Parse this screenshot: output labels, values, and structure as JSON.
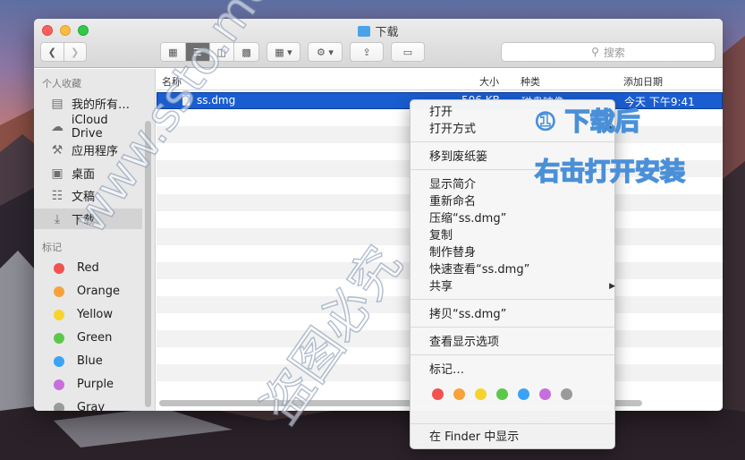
{
  "window": {
    "title": "下载"
  },
  "toolbar": {
    "search_placeholder": "搜索"
  },
  "sidebar": {
    "favorites_header": "个人收藏",
    "favorites": [
      {
        "label": "我的所有…",
        "icon": "all-files-icon"
      },
      {
        "label": "iCloud Drive",
        "icon": "cloud-icon"
      },
      {
        "label": "应用程序",
        "icon": "applications-icon"
      },
      {
        "label": "桌面",
        "icon": "desktop-icon"
      },
      {
        "label": "文稿",
        "icon": "documents-icon"
      },
      {
        "label": "下载",
        "icon": "download-icon",
        "selected": true
      }
    ],
    "tags_header": "标记",
    "tags": [
      {
        "label": "Red",
        "color": "#f3524f"
      },
      {
        "label": "Orange",
        "color": "#f7a23a"
      },
      {
        "label": "Yellow",
        "color": "#f7d32e"
      },
      {
        "label": "Green",
        "color": "#5cc84b"
      },
      {
        "label": "Blue",
        "color": "#3ba3f5"
      },
      {
        "label": "Purple",
        "color": "#c66fdc"
      },
      {
        "label": "Gray",
        "color": "#9a9a9a"
      }
    ]
  },
  "columns": {
    "name": "名称",
    "size": "大小",
    "kind": "种类",
    "date_added": "添加日期"
  },
  "files": [
    {
      "name": "ss.dmg",
      "size": "506 KB",
      "kind": "磁盘映像",
      "date_added": "今天 下午9:41"
    }
  ],
  "context_menu": {
    "items": [
      {
        "label": "打开"
      },
      {
        "label": "打开方式",
        "submenu": true
      },
      {
        "label": "移到废纸篓"
      },
      {
        "label": "显示简介"
      },
      {
        "label": "重新命名"
      },
      {
        "label": "压缩“ss.dmg”"
      },
      {
        "label": "复制"
      },
      {
        "label": "制作替身"
      },
      {
        "label": "快速查看“ss.dmg”"
      },
      {
        "label": "共享",
        "submenu": true
      },
      {
        "label": "拷贝“ss.dmg”"
      },
      {
        "label": "查看显示选项"
      },
      {
        "label": "标记…"
      },
      {
        "label": "在 Finder 中显示"
      }
    ],
    "tag_colors": [
      "#f3524f",
      "#f7a23a",
      "#f7d32e",
      "#5cc84b",
      "#3ba3f5",
      "#c66fdc",
      "#9a9a9a"
    ]
  },
  "annotation": {
    "line1": "① 下载后",
    "line2": "右击打开安装"
  },
  "watermark": {
    "line1": "www.ssto.me专用",
    "line2": "盗图必究"
  }
}
